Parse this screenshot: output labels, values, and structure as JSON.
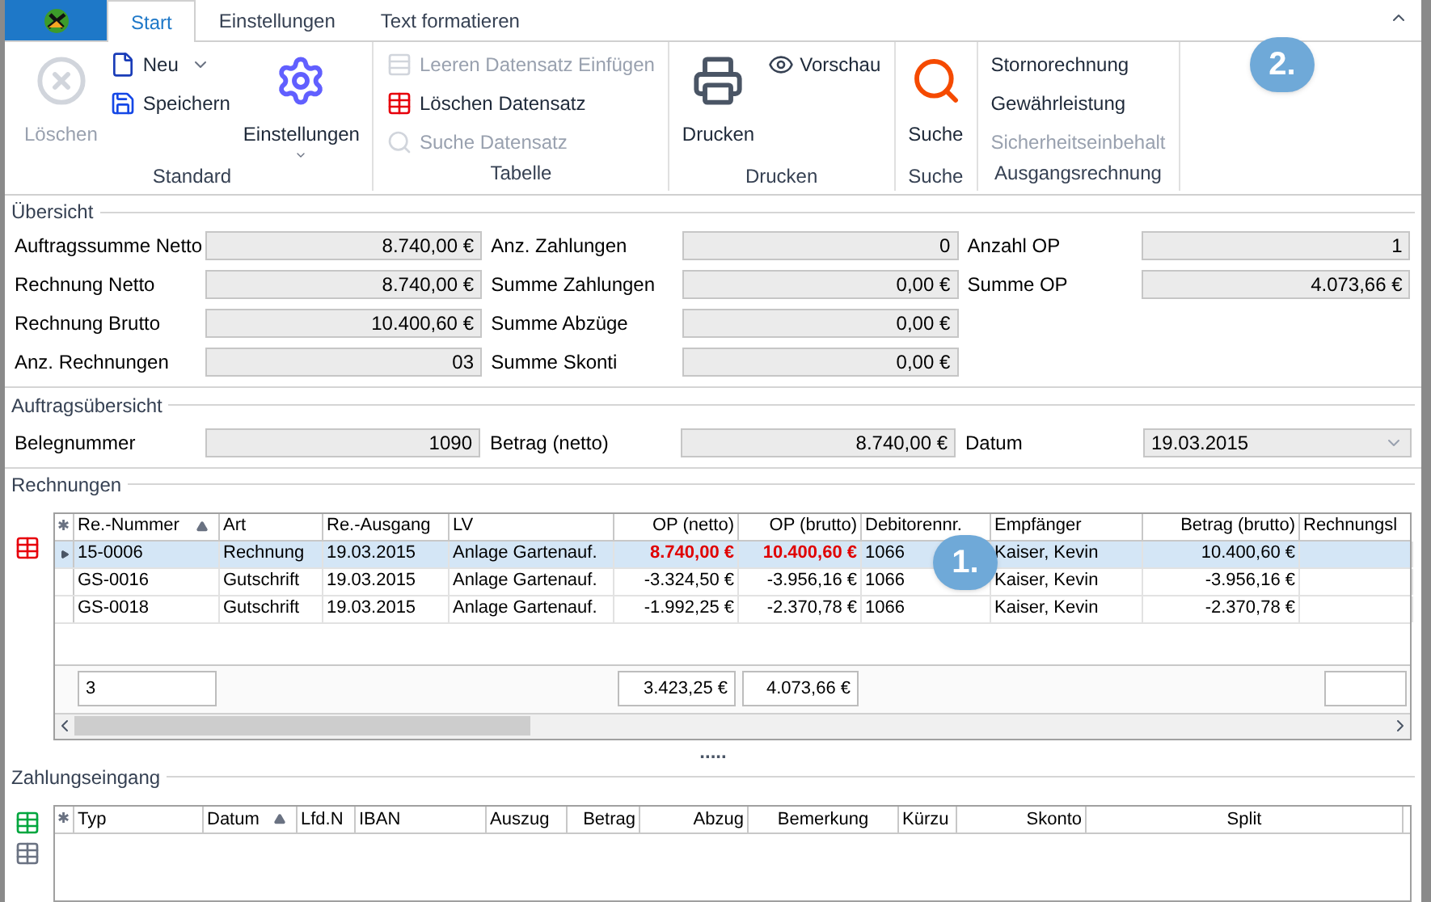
{
  "ribbon": {
    "tabs": [
      {
        "label": "Start",
        "selected": true
      },
      {
        "label": "Einstellungen",
        "selected": false
      },
      {
        "label": "Text formatieren",
        "selected": false
      }
    ],
    "groups": [
      {
        "title": "Standard",
        "buttons": [
          {
            "label": "Löschen",
            "kind": "large",
            "disabled": true
          },
          {
            "label": "Neu",
            "kind": "small",
            "disabled": false,
            "dropdown": true
          },
          {
            "label": "Speichern",
            "kind": "small",
            "disabled": false
          },
          {
            "label": "Einstellungen",
            "kind": "large",
            "disabled": false,
            "dropdown": true
          }
        ]
      },
      {
        "title": "Tabelle",
        "buttons": [
          {
            "label": "Leeren Datensatz Einfügen",
            "kind": "small",
            "disabled": true
          },
          {
            "label": "Löschen Datensatz",
            "kind": "small",
            "disabled": false
          },
          {
            "label": "Suche Datensatz",
            "kind": "small",
            "disabled": true
          }
        ]
      },
      {
        "title": "Drucken",
        "buttons": [
          {
            "label": "Drucken",
            "kind": "large",
            "disabled": false
          },
          {
            "label": "Vorschau",
            "kind": "small",
            "disabled": false
          }
        ]
      },
      {
        "title": "Suche",
        "buttons": [
          {
            "label": "Suche",
            "kind": "large",
            "disabled": false
          }
        ]
      },
      {
        "title": "Ausgangsrechnung",
        "buttons": [
          {
            "label": "Stornorechnung",
            "kind": "text",
            "disabled": false
          },
          {
            "label": "Gewährleistung",
            "kind": "text",
            "disabled": false
          },
          {
            "label": "Sicherheitseinbehalt",
            "kind": "text",
            "disabled": true
          }
        ]
      }
    ]
  },
  "callouts": [
    "1.",
    "2."
  ],
  "overview": {
    "title": "Übersicht",
    "columns": [
      [
        {
          "label": "Auftragssumme Netto",
          "value": "8.740,00 €"
        },
        {
          "label": "Rechnung Netto",
          "value": "8.740,00 €"
        },
        {
          "label": "Rechnung Brutto",
          "value": "10.400,60 €"
        },
        {
          "label": "Anz. Rechnungen",
          "value": "03"
        }
      ],
      [
        {
          "label": "Anz. Zahlungen",
          "value": "0"
        },
        {
          "label": "Summe Zahlungen",
          "value": "0,00 €"
        },
        {
          "label": "Summe Abzüge",
          "value": "0,00 €"
        },
        {
          "label": "Summe Skonti",
          "value": "0,00 €"
        }
      ],
      [
        {
          "label": "Anzahl OP",
          "value": "1"
        },
        {
          "label": "Summe OP",
          "value": "4.073,66 €"
        }
      ]
    ]
  },
  "order_overview": {
    "title": "Auftragsübersicht",
    "fields": [
      {
        "label": "Belegnummer",
        "value": "1090",
        "kind": "number"
      },
      {
        "label": "Betrag (netto)",
        "value": "8.740,00 €",
        "kind": "number"
      },
      {
        "label": "Datum",
        "value": "19.03.2015",
        "kind": "dropdown"
      }
    ]
  },
  "invoices": {
    "title": "Rechnungen",
    "columns": [
      "Re.-Nummer",
      "Art",
      "Re.-Ausgang",
      "LV",
      "OP (netto)",
      "OP (brutto)",
      "Debitorennr.",
      "Empfänger",
      "Betrag (brutto)",
      "Rechnungsl"
    ],
    "rows": [
      {
        "selected": true,
        "highlighted": true,
        "cells": [
          "15-0006",
          "Rechnung",
          "19.03.2015",
          "Anlage Gartenauf.",
          "8.740,00 €",
          "10.400,60 €",
          "1066",
          "Kaiser, Kevin",
          "10.400,60 €",
          ""
        ]
      },
      {
        "selected": false,
        "highlighted": false,
        "cells": [
          "GS-0016",
          "Gutschrift",
          "19.03.2015",
          "Anlage Gartenauf.",
          "-3.324,50 €",
          "-3.956,16 €",
          "1066",
          "Kaiser, Kevin",
          "-3.956,16 €",
          ""
        ]
      },
      {
        "selected": false,
        "highlighted": false,
        "cells": [
          "GS-0018",
          "Gutschrift",
          "19.03.2015",
          "Anlage Gartenauf.",
          "-1.992,25 €",
          "-2.370,78 €",
          "1066",
          "Kaiser, Kevin",
          "-2.370,78 €",
          ""
        ]
      }
    ],
    "corner_mark": "✱",
    "footer": {
      "count": "3",
      "op_netto": "3.423,25 €",
      "op_brutto": "4.073,66 €"
    }
  },
  "splitter": ".....",
  "payments": {
    "title": "Zahlungseingang",
    "corner_mark": "✱",
    "columns": [
      "Typ",
      "Datum",
      "Lfd.N",
      "IBAN",
      "Auszug",
      "Betrag",
      "Abzug",
      "Bemerkung",
      "Kürzu",
      "Skonto",
      "Split"
    ]
  }
}
